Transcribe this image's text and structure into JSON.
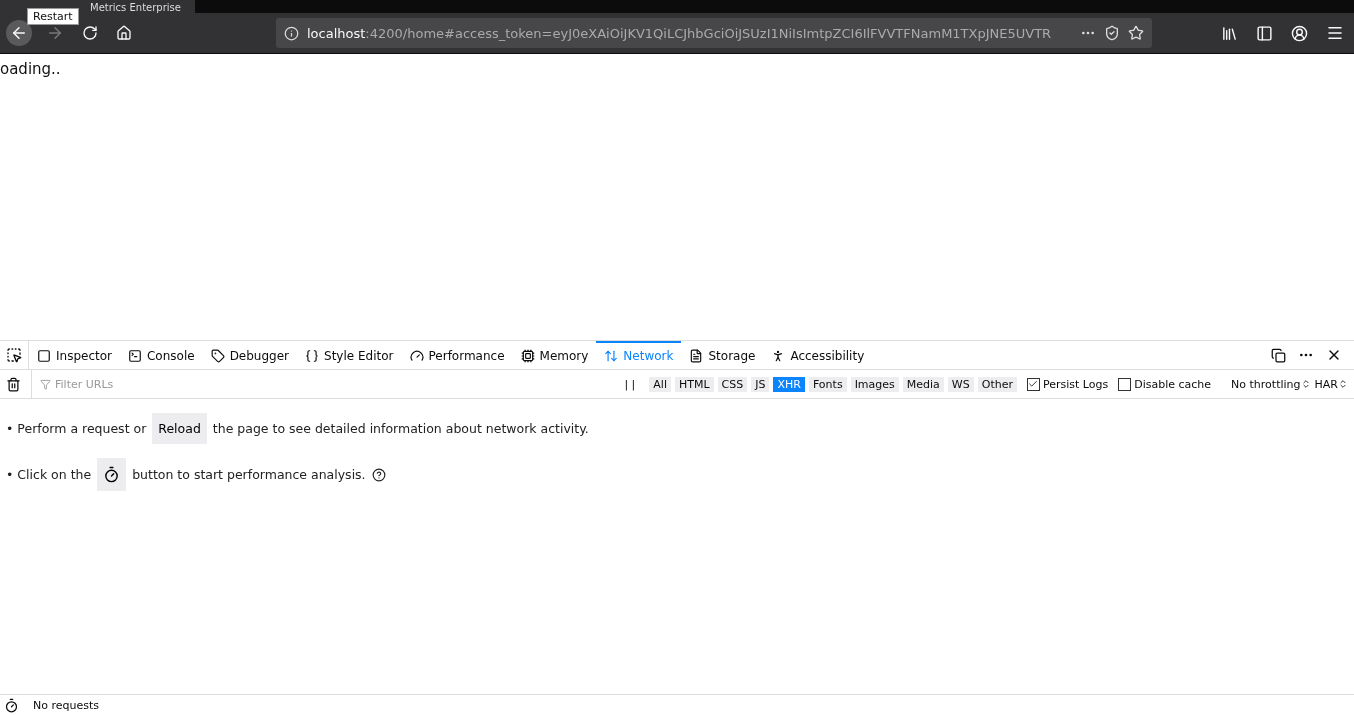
{
  "browser": {
    "tab_title": "Metrics Enterprise",
    "tooltip": "Restart",
    "url_host": "localhost",
    "url_rest": ":4200/home#access_token=eyJ0eXAiOiJKV1QiLCJhbGciOiJSUzI1NiIsImtpZCI6IlFVVTFNamM1TXpJNE5UVTR"
  },
  "page": {
    "text": "oading.."
  },
  "devtools": {
    "tabs": [
      {
        "label": "Inspector",
        "selected": false
      },
      {
        "label": "Console",
        "selected": false
      },
      {
        "label": "Debugger",
        "selected": false
      },
      {
        "label": "Style Editor",
        "selected": false
      },
      {
        "label": "Performance",
        "selected": false
      },
      {
        "label": "Memory",
        "selected": false
      },
      {
        "label": "Network",
        "selected": true
      },
      {
        "label": "Storage",
        "selected": false
      },
      {
        "label": "Accessibility",
        "selected": false
      }
    ],
    "filter_placeholder": "Filter URLs",
    "pause": "| |",
    "type_filters": [
      {
        "label": "All",
        "selected": false
      },
      {
        "label": "HTML",
        "selected": false
      },
      {
        "label": "CSS",
        "selected": false
      },
      {
        "label": "JS",
        "selected": false
      },
      {
        "label": "XHR",
        "selected": true
      },
      {
        "label": "Fonts",
        "selected": false
      },
      {
        "label": "Images",
        "selected": false
      },
      {
        "label": "Media",
        "selected": false
      },
      {
        "label": "WS",
        "selected": false
      },
      {
        "label": "Other",
        "selected": false
      }
    ],
    "options": [
      {
        "label": "Persist Logs",
        "checked": true
      },
      {
        "label": "Disable cache",
        "checked": false
      }
    ],
    "throttling": "No throttling",
    "har": "HAR",
    "hint1": {
      "before": "• Perform a request or",
      "button": "Reload",
      "after": "the page to see detailed information about network activity."
    },
    "hint2": {
      "before": "• Click on the",
      "after": "button to start performance analysis."
    },
    "status": "No requests"
  }
}
